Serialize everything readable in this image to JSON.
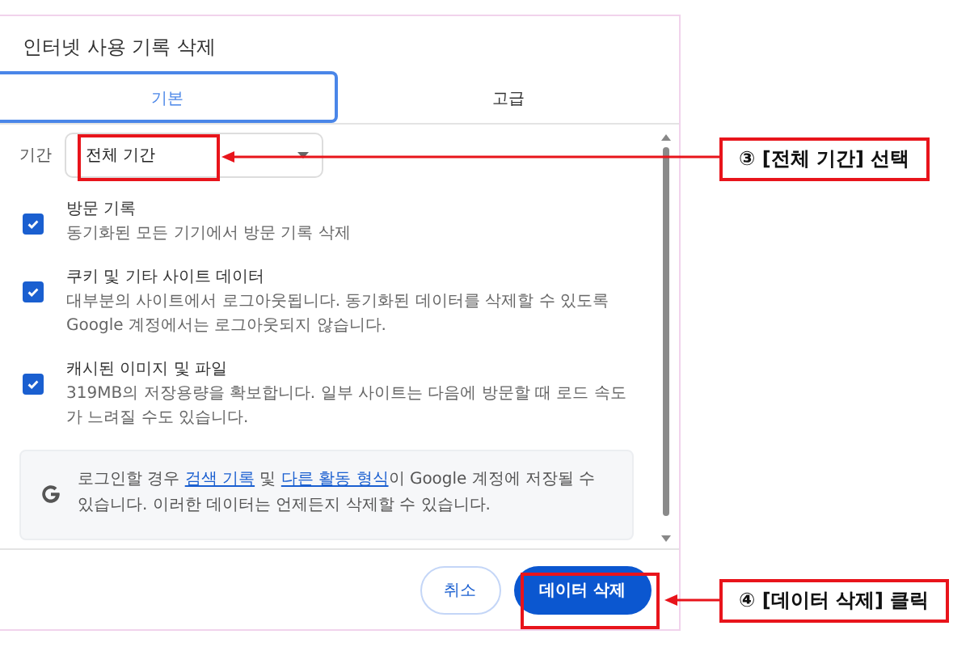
{
  "dialog": {
    "title": "인터넷 사용 기록 삭제",
    "tabs": [
      {
        "label": "기본",
        "selected": true
      },
      {
        "label": "고급",
        "selected": false
      }
    ],
    "period": {
      "label": "기간",
      "value": "전체 기간"
    },
    "options": [
      {
        "title": "방문 기록",
        "description": "동기화된 모든 기기에서 방문 기록 삭제",
        "checked": true
      },
      {
        "title": "쿠키 및 기타 사이트 데이터",
        "description": "대부분의 사이트에서 로그아웃됩니다. 동기화된 데이터를 삭제할 수 있도록 Google 계정에서는 로그아웃되지 않습니다.",
        "checked": true
      },
      {
        "title": "캐시된 이미지 및 파일",
        "description": "319MB의 저장용량을 확보합니다. 일부 사이트는 다음에 방문할 때 로드 속도가 느려질 수도 있습니다.",
        "checked": true
      }
    ],
    "notice": [
      {
        "kind": "text",
        "text": "로그인할 경우 "
      },
      {
        "kind": "link",
        "text": "검색 기록"
      },
      {
        "kind": "text",
        "text": " 및 "
      },
      {
        "kind": "link",
        "text": "다른 활동 형식"
      },
      {
        "kind": "text",
        "text": "이 Google 계정에 저장될 수 있습니다. 이러한 데이터는 언제든지 삭제할 수 있습니다."
      }
    ],
    "buttons": [
      {
        "label": "취소",
        "kind": "secondary"
      },
      {
        "label": "데이터 삭제",
        "kind": "primary"
      }
    ]
  },
  "annotations": [
    {
      "text": "③ [전체 기간] 선택"
    },
    {
      "text": "④ [데이터 삭제] 클릭"
    }
  ]
}
